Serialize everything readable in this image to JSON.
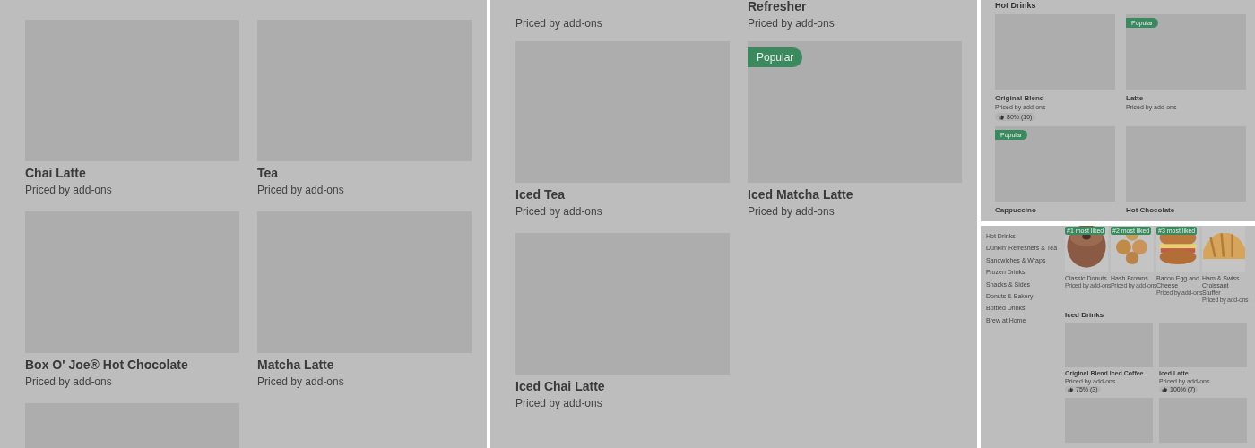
{
  "panels": [
    {
      "kind": "grid",
      "items": [
        {
          "kind": "product",
          "name": "Chai Latte",
          "subtitle": "Priced by add-ons"
        },
        {
          "kind": "product",
          "name": "Tea",
          "subtitle": "Priced by add-ons"
        },
        {
          "kind": "product",
          "name": "Box O' Joe® Hot Chocolate",
          "subtitle": "Priced by add-ons"
        },
        {
          "kind": "product",
          "name": "Matcha Latte",
          "subtitle": "Priced by add-ons"
        },
        {
          "kind": "placeholder"
        }
      ]
    },
    {
      "kind": "grid",
      "items": [
        {
          "kind": "partial",
          "subtitle": "Priced by add-ons"
        },
        {
          "kind": "partial",
          "name": "Refresher",
          "subtitle": "Priced by add-ons"
        },
        {
          "kind": "product",
          "name": "Iced Tea",
          "subtitle": "Priced by add-ons"
        },
        {
          "kind": "product",
          "name": "Iced Matcha Latte",
          "subtitle": "Priced by add-ons",
          "badge": "Popular"
        },
        {
          "kind": "product",
          "name": "Iced Chai Latte",
          "subtitle": "Priced by add-ons"
        }
      ]
    },
    {
      "kind": "small-grid",
      "heading": "Hot Drinks",
      "items": [
        {
          "kind": "product",
          "name": "Original Blend",
          "subtitle": "Priced by add-ons",
          "rating": "80% (10)"
        },
        {
          "kind": "product",
          "name": "Latte",
          "subtitle": "Priced by add-ons",
          "badge": "Popular"
        },
        {
          "kind": "product",
          "name": "Cappuccino",
          "badge": "Popular"
        },
        {
          "kind": "product",
          "name": "Hot Chocolate"
        }
      ]
    },
    {
      "kind": "menu",
      "categories": [
        "Hot Drinks",
        "Dunkin' Refreshers & Tea",
        "Sandwiches & Wraps",
        "Frozen Drinks",
        "Snacks & Sides",
        "Donuts & Bakery",
        "Bottled Drinks",
        "Brew at Home"
      ],
      "featured": [
        {
          "name": "Classic Donuts",
          "subtitle": "Priced by add-ons",
          "badge": "#1 most liked"
        },
        {
          "name": "Hash Browns",
          "subtitle": "Priced by add-ons",
          "badge": "#2 most liked"
        },
        {
          "name": "Bacon Egg and Cheese",
          "subtitle": "Priced by add-ons",
          "badge": "#3 most liked"
        },
        {
          "name": "Ham & Swiss Croissant Stuffer",
          "subtitle": "Priced by add-ons"
        }
      ],
      "heading": "Iced Drinks",
      "items": [
        {
          "kind": "product",
          "name": "Original Blend Iced Coffee",
          "subtitle": "Priced by add-ons",
          "rating": "75% (3)"
        },
        {
          "kind": "product",
          "name": "Iced Latte",
          "subtitle": "Priced by add-ons",
          "rating": "100% (7)"
        },
        {
          "kind": "placeholder"
        },
        {
          "kind": "placeholder"
        }
      ]
    }
  ]
}
